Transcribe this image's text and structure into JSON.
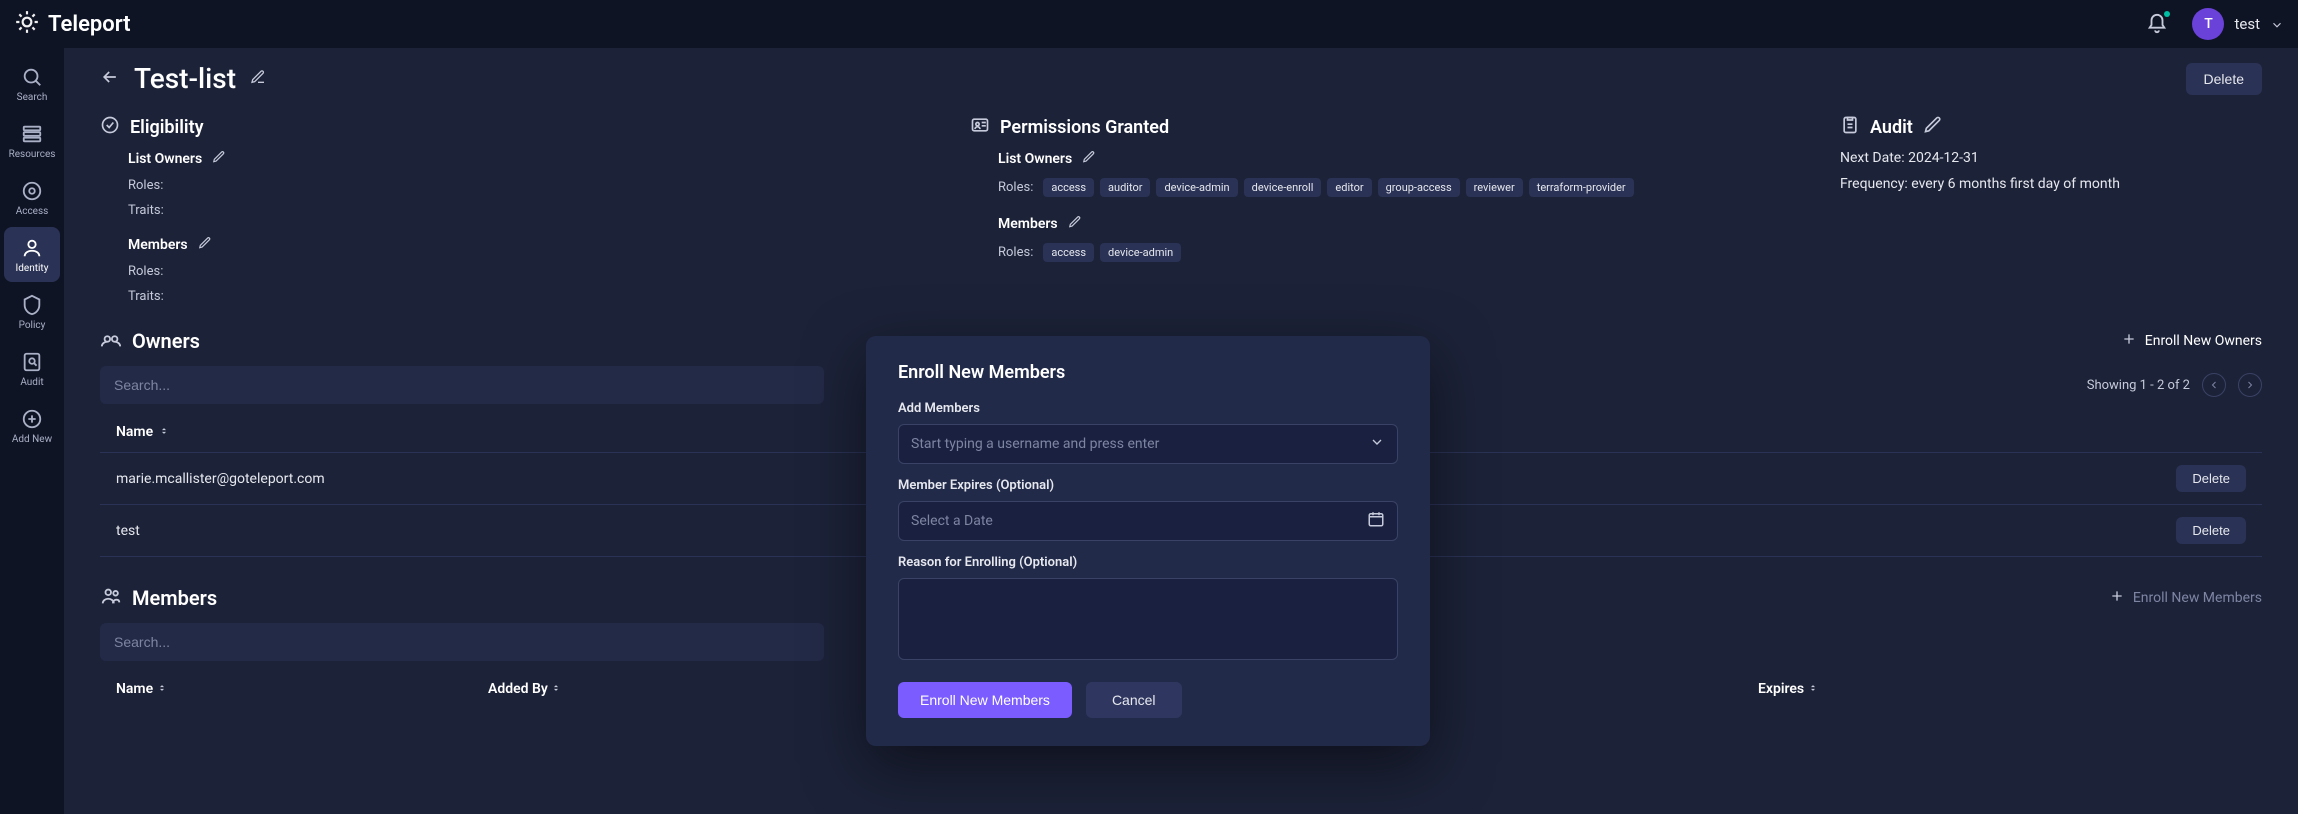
{
  "brand": {
    "name": "Teleport"
  },
  "user": {
    "initial": "T",
    "name": "test"
  },
  "rail": {
    "items": [
      {
        "id": "search",
        "label": "Search"
      },
      {
        "id": "resources",
        "label": "Resources"
      },
      {
        "id": "access",
        "label": "Access"
      },
      {
        "id": "identity",
        "label": "Identity"
      },
      {
        "id": "policy",
        "label": "Policy"
      },
      {
        "id": "audit",
        "label": "Audit"
      },
      {
        "id": "addnew",
        "label": "Add New"
      }
    ]
  },
  "page": {
    "title": "Test-list",
    "delete_label": "Delete"
  },
  "eligibility": {
    "heading": "Eligibility",
    "list_owners": {
      "heading": "List Owners",
      "roles_label": "Roles:",
      "traits_label": "Traits:"
    },
    "members": {
      "heading": "Members",
      "roles_label": "Roles:",
      "traits_label": "Traits:"
    }
  },
  "permissions": {
    "heading": "Permissions Granted",
    "list_owners": {
      "heading": "List Owners",
      "roles_label": "Roles:",
      "tags": [
        "access",
        "auditor",
        "device-admin",
        "device-enroll",
        "editor",
        "group-access",
        "reviewer",
        "terraform-provider"
      ]
    },
    "members": {
      "heading": "Members",
      "roles_label": "Roles:",
      "tags": [
        "access",
        "device-admin"
      ]
    }
  },
  "audit": {
    "heading": "Audit",
    "next_date_label": "Next Date:",
    "next_date_value": "2024-12-31",
    "freq_label": "Frequency:",
    "freq_value": "every 6 months first day of month"
  },
  "owners": {
    "heading": "Owners",
    "enroll_label": "Enroll New Owners",
    "search_placeholder": "Search...",
    "pager_text": "Showing 1 - 2 of 2",
    "columns": {
      "name": "Name"
    },
    "rows": [
      {
        "name": "marie.mcallister@goteleport.com",
        "delete": "Delete"
      },
      {
        "name": "test",
        "delete": "Delete"
      }
    ]
  },
  "members_section": {
    "heading": "Members",
    "enroll_label": "Enroll New Members",
    "search_placeholder": "Search...",
    "columns": {
      "name": "Name",
      "added_by": "Added By",
      "expires": "Expires"
    }
  },
  "modal": {
    "title": "Enroll New Members",
    "add_members_label": "Add Members",
    "add_members_placeholder": "Start typing a username and press enter",
    "expires_label": "Member Expires (Optional)",
    "expires_placeholder": "Select a Date",
    "reason_label": "Reason for Enrolling (Optional)",
    "submit_label": "Enroll New Members",
    "cancel_label": "Cancel"
  }
}
